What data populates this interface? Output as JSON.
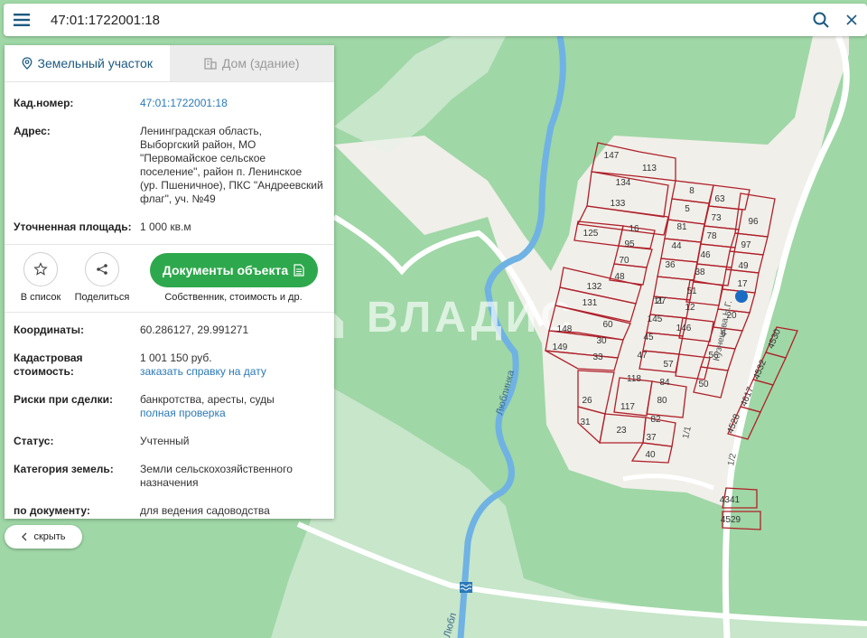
{
  "search": {
    "value": "47:01:1722001:18"
  },
  "tabs": [
    {
      "label": "Земельный участок"
    },
    {
      "label": "Дом (здание)"
    }
  ],
  "info": {
    "cadnum_label": "Кад.номер:",
    "cadnum_value": "47:01:1722001:18",
    "address_label": "Адрес:",
    "address_lines": [
      "Ленинградская область,",
      "Выборгский район, МО",
      "\"Первомайское сельское",
      "поселение\", район п. Ленинское",
      "(ур. Пшеничное), ПКС \"Андреевский",
      "флаг\", уч. №49"
    ],
    "area_label": "Уточненная площадь:",
    "area_value": "1 000 кв.м"
  },
  "actions": {
    "favorite_label": "В список",
    "share_label": "Поделиться",
    "docs_button_label": "Документы объекта",
    "docs_sub_label": "Собственник, стоимость и др."
  },
  "details": {
    "coords_label": "Координаты:",
    "coords_value": "60.286127, 29.991271",
    "cost_label_1": "Кадастровая",
    "cost_label_2": "стоимость:",
    "cost_value": "1 001 150 руб.",
    "cost_link": "заказать справку на дату",
    "risks_label": "Риски при сделки:",
    "risks_value": "банкротства, аресты, суды",
    "risks_link": "полная проверка",
    "status_label": "Статус:",
    "status_value": "Учтенный",
    "category_label": "Категория земель:",
    "category_lines": [
      "Земли сельскохозяйственного",
      "назначения"
    ],
    "usage_label": "по документу:",
    "usage_value": "для ведения садоводства"
  },
  "hide_label": "скрыть",
  "map": {
    "watermark": "ВЛАДИС",
    "river_label": "Люблинка",
    "river_label_2": "Любл",
    "street_label": "Кузнецова Н.Г.",
    "road_label_a": "1/1",
    "road_label_b": "1/2",
    "plots_a": [
      "147",
      "113",
      "134",
      "133",
      "8",
      "63",
      "5",
      "73",
      "96",
      "125",
      "16",
      "81",
      "78",
      "95",
      "44",
      "46",
      "97",
      "70",
      "36",
      "38",
      "49",
      "48",
      "51",
      "17",
      "132",
      "11",
      "131",
      "27",
      "12",
      "20",
      "60",
      "145",
      "146",
      "148",
      "30",
      "45",
      "6",
      "149",
      "33",
      "47",
      "56",
      "57",
      "50",
      "118",
      "84",
      "26",
      "80",
      "117",
      "82",
      "31",
      "23",
      "37",
      "40"
    ],
    "plots_b": [
      "4530",
      "4532",
      "4617",
      "4528",
      "4341",
      "4529"
    ],
    "colors": {
      "forest": "#9fd7a6",
      "clearing": "#f0efe9",
      "water": "#6fb2e3",
      "road": "#ffffff",
      "parcel": "#b01f2a",
      "marker": "#1a6bc2"
    }
  }
}
